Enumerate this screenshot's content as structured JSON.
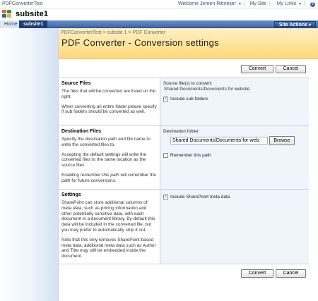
{
  "topbar": {
    "site_name": "PDFConverterTest",
    "welcome": "Welcome Jeroen Ritmeijer",
    "my_site": "My Site",
    "my_links": "My Links"
  },
  "header": {
    "title": "subsite1"
  },
  "nav": {
    "tabs": [
      "Home",
      "subsite1"
    ],
    "site_actions": "Site Actions"
  },
  "page": {
    "breadcrumb": "PDFConverterTest > subsite 1 > PDF Converter",
    "title": "PDF Converter - Conversion settings"
  },
  "buttons": {
    "convert": "Convert",
    "cancel": "Cancel",
    "browse": "Browse"
  },
  "sections": {
    "source": {
      "heading": "Source Files",
      "desc1": "The files that will be converted are listed on the right.",
      "desc2": "When converting an entire folder please specify if sub folders should be converted as well.",
      "label": "Source file(s) to convert:",
      "value": "Shared Documents/Documents for website",
      "checkbox_label": "Include sub folders",
      "checkbox_checked": true
    },
    "destination": {
      "heading": "Destination Files",
      "desc1": "Specify the destination path and file name to write the converted files to.",
      "desc2": "Accepting the default settings will write the converted files to the same location as the source files.",
      "desc3_pre": "Enabling ",
      "desc3_em": "remember this path",
      "desc3_post": " will remember the path for future conversions.",
      "label": "Destination folder:",
      "folder_value": "Shared Documents/Documents for web:",
      "checkbox_label": "Remember this path",
      "checkbox_checked": false
    },
    "settings": {
      "heading": "Settings",
      "desc1_pre": "SharePoint can store additional columns of ",
      "desc1_em": "meta data",
      "desc1_post": ", such as pricing information and other potentially sensitive data, with each document in a document library. By default this data will be included in the converted file, but you may prefer to automatically strip it out.",
      "desc2": "Note that this only removes SharePoint based meta data, additional meta data such as Author and Title may still be embedded inside the document.",
      "checkbox_label": "Include SharePoint meta data",
      "checkbox_checked": true
    }
  }
}
